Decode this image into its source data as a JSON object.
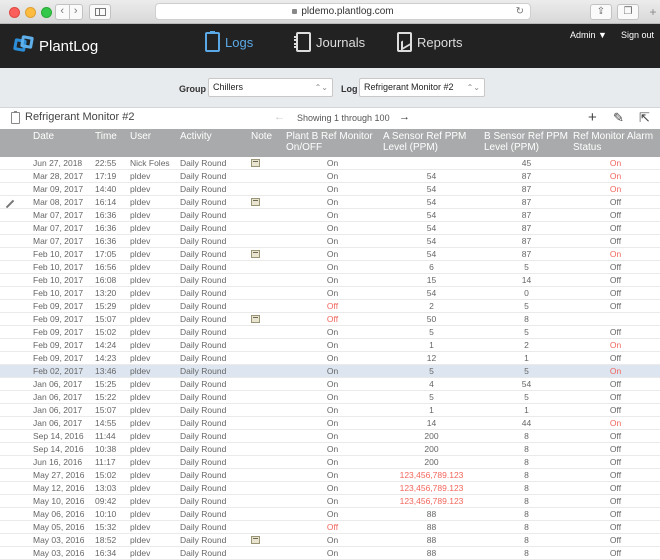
{
  "browser": {
    "url": "pldemo.plantlog.com",
    "reload_icon": "reload-icon",
    "back_icon": "chevron-left-icon",
    "forward_icon": "chevron-right-icon"
  },
  "app": {
    "brand": "PlantLog",
    "nav": [
      {
        "label": "Logs",
        "icon": "clipboard-icon",
        "active": true
      },
      {
        "label": "Journals",
        "icon": "notebook-icon",
        "active": false
      },
      {
        "label": "Reports",
        "icon": "chart-icon",
        "active": false
      }
    ],
    "user_menu": "Admin ▼",
    "sign_out": "Sign out",
    "accent": "#5aa9e6"
  },
  "filters": {
    "group_label": "Group",
    "group_value": "Chillers",
    "log_label": "Log",
    "log_value": "Refrigerant Monitor #2"
  },
  "toolbar": {
    "title": "Refrigerant Monitor #2",
    "showing": "Showing 1 through 100",
    "prev": "←",
    "next": "→",
    "add": "+",
    "edit": "✎",
    "export": "⇱"
  },
  "table": {
    "columns": [
      "Date",
      "Time",
      "User",
      "Activity",
      "Note",
      "Plant B Ref Monitor On/OFF",
      "A Sensor Ref PPM Level (PPM)",
      "B Sensor Ref PPM Level (PPM)",
      "Ref Monitor Alarm Status"
    ],
    "rows": [
      {
        "date": "Jun 27, 2018",
        "time": "22:55",
        "user": "Nick Foles",
        "activity": "Daily Round",
        "note": true,
        "onoff": "On",
        "a": "",
        "b": "45",
        "alarm": "On"
      },
      {
        "date": "Mar 28, 2017",
        "time": "17:19",
        "user": "pldev",
        "activity": "Daily Round",
        "note": false,
        "onoff": "On",
        "a": "54",
        "b": "87",
        "alarm": "On"
      },
      {
        "date": "Mar 09, 2017",
        "time": "14:40",
        "user": "pldev",
        "activity": "Daily Round",
        "note": false,
        "onoff": "On",
        "a": "54",
        "b": "87",
        "alarm": "On"
      },
      {
        "date": "Mar 08, 2017",
        "time": "16:14",
        "user": "pldev",
        "activity": "Daily Round",
        "note": true,
        "onoff": "On",
        "a": "54",
        "b": "87",
        "alarm": "Off",
        "edit": true
      },
      {
        "date": "Mar 07, 2017",
        "time": "16:36",
        "user": "pldev",
        "activity": "Daily Round",
        "note": false,
        "onoff": "On",
        "a": "54",
        "b": "87",
        "alarm": "Off"
      },
      {
        "date": "Mar 07, 2017",
        "time": "16:36",
        "user": "pldev",
        "activity": "Daily Round",
        "note": false,
        "onoff": "On",
        "a": "54",
        "b": "87",
        "alarm": "Off"
      },
      {
        "date": "Mar 07, 2017",
        "time": "16:36",
        "user": "pldev",
        "activity": "Daily Round",
        "note": false,
        "onoff": "On",
        "a": "54",
        "b": "87",
        "alarm": "Off"
      },
      {
        "date": "Feb 10, 2017",
        "time": "17:05",
        "user": "pldev",
        "activity": "Daily Round",
        "note": true,
        "onoff": "On",
        "a": "54",
        "b": "87",
        "alarm": "On"
      },
      {
        "date": "Feb 10, 2017",
        "time": "16:56",
        "user": "pldev",
        "activity": "Daily Round",
        "note": false,
        "onoff": "On",
        "a": "6",
        "b": "5",
        "alarm": "Off"
      },
      {
        "date": "Feb 10, 2017",
        "time": "16:08",
        "user": "pldev",
        "activity": "Daily Round",
        "note": false,
        "onoff": "On",
        "a": "15",
        "b": "14",
        "alarm": "Off"
      },
      {
        "date": "Feb 10, 2017",
        "time": "13:20",
        "user": "pldev",
        "activity": "Daily Round",
        "note": false,
        "onoff": "On",
        "a": "54",
        "b": "0",
        "alarm": "Off"
      },
      {
        "date": "Feb 09, 2017",
        "time": "15:29",
        "user": "pldev",
        "activity": "Daily Round",
        "note": false,
        "onoff": "Off",
        "a": "2",
        "b": "5",
        "alarm": "Off"
      },
      {
        "date": "Feb 09, 2017",
        "time": "15:07",
        "user": "pldev",
        "activity": "Daily Round",
        "note": true,
        "onoff": "Off",
        "a": "50",
        "b": "8",
        "alarm": ""
      },
      {
        "date": "Feb 09, 2017",
        "time": "15:02",
        "user": "pldev",
        "activity": "Daily Round",
        "note": false,
        "onoff": "On",
        "a": "5",
        "b": "5",
        "alarm": "Off"
      },
      {
        "date": "Feb 09, 2017",
        "time": "14:24",
        "user": "pldev",
        "activity": "Daily Round",
        "note": false,
        "onoff": "On",
        "a": "1",
        "b": "2",
        "alarm": "On"
      },
      {
        "date": "Feb 09, 2017",
        "time": "14:23",
        "user": "pldev",
        "activity": "Daily Round",
        "note": false,
        "onoff": "On",
        "a": "12",
        "b": "1",
        "alarm": "Off"
      },
      {
        "date": "Feb 02, 2017",
        "time": "13:46",
        "user": "pldev",
        "activity": "Daily Round",
        "note": false,
        "onoff": "On",
        "a": "5",
        "b": "5",
        "alarm": "On",
        "selected": true
      },
      {
        "date": "Jan 06, 2017",
        "time": "15:25",
        "user": "pldev",
        "activity": "Daily Round",
        "note": false,
        "onoff": "On",
        "a": "4",
        "b": "54",
        "alarm": "Off"
      },
      {
        "date": "Jan 06, 2017",
        "time": "15:22",
        "user": "pldev",
        "activity": "Daily Round",
        "note": false,
        "onoff": "On",
        "a": "5",
        "b": "5",
        "alarm": "Off"
      },
      {
        "date": "Jan 06, 2017",
        "time": "15:07",
        "user": "pldev",
        "activity": "Daily Round",
        "note": false,
        "onoff": "On",
        "a": "1",
        "b": "1",
        "alarm": "Off"
      },
      {
        "date": "Jan 06, 2017",
        "time": "14:55",
        "user": "pldev",
        "activity": "Daily Round",
        "note": false,
        "onoff": "On",
        "a": "14",
        "b": "44",
        "alarm": "On"
      },
      {
        "date": "Sep 14, 2016",
        "time": "11:44",
        "user": "pldev",
        "activity": "Daily Round",
        "note": false,
        "onoff": "On",
        "a": "200",
        "b": "8",
        "alarm": "Off"
      },
      {
        "date": "Sep 14, 2016",
        "time": "10:38",
        "user": "pldev",
        "activity": "Daily Round",
        "note": false,
        "onoff": "On",
        "a": "200",
        "b": "8",
        "alarm": "Off"
      },
      {
        "date": "Jun 16, 2016",
        "time": "11:17",
        "user": "pldev",
        "activity": "Daily Round",
        "note": false,
        "onoff": "On",
        "a": "200",
        "b": "8",
        "alarm": "Off"
      },
      {
        "date": "May 27, 2016",
        "time": "15:02",
        "user": "pldev",
        "activity": "Daily Round",
        "note": false,
        "onoff": "On",
        "a": "123,456,789.123",
        "b": "8",
        "alarm": "Off",
        "a_red": true
      },
      {
        "date": "May 12, 2016",
        "time": "13:03",
        "user": "pldev",
        "activity": "Daily Round",
        "note": false,
        "onoff": "On",
        "a": "123,456,789.123",
        "b": "8",
        "alarm": "Off",
        "a_red": true
      },
      {
        "date": "May 10, 2016",
        "time": "09:42",
        "user": "pldev",
        "activity": "Daily Round",
        "note": false,
        "onoff": "On",
        "a": "123,456,789.123",
        "b": "8",
        "alarm": "Off",
        "a_red": true
      },
      {
        "date": "May 06, 2016",
        "time": "10:10",
        "user": "pldev",
        "activity": "Daily Round",
        "note": false,
        "onoff": "On",
        "a": "88",
        "b": "8",
        "alarm": "Off"
      },
      {
        "date": "May 05, 2016",
        "time": "15:32",
        "user": "pldev",
        "activity": "Daily Round",
        "note": false,
        "onoff": "Off",
        "a": "88",
        "b": "8",
        "alarm": "Off"
      },
      {
        "date": "May 03, 2016",
        "time": "18:52",
        "user": "pldev",
        "activity": "Daily Round",
        "note": true,
        "onoff": "On",
        "a": "88",
        "b": "8",
        "alarm": "Off"
      },
      {
        "date": "May 03, 2016",
        "time": "16:34",
        "user": "pldev",
        "activity": "Daily Round",
        "note": false,
        "onoff": "On",
        "a": "88",
        "b": "8",
        "alarm": "Off"
      }
    ]
  }
}
